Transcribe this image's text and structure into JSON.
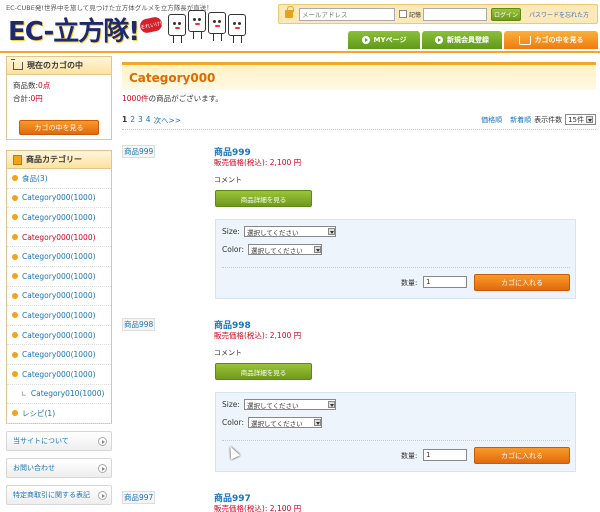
{
  "header": {
    "tagline": "EC-CUBE発!世界中を旅して見つけた立方体グルメを立方隊長が直送！",
    "logo_text": "EC-立方隊!",
    "logo_badge": "それいけ!",
    "login": {
      "email_placeholder": "メールアドレス",
      "remember_label": "記憶",
      "login_button": "ログイン",
      "forgot_link": "パスワードを忘れた方"
    },
    "nav": {
      "mypage": "MYページ",
      "register": "新規会員登録",
      "cart": "カゴの中を見る"
    },
    "colors": {
      "accent": "#f5a623",
      "green": "#6e9a1a",
      "orange": "#e3690c",
      "link": "#1a74b8",
      "price_red": "#d0021b"
    }
  },
  "sidebar": {
    "cart": {
      "title": "現在のカゴの中",
      "count_label": "商品数:",
      "count_value": "0点",
      "total_label": "合計:",
      "total_value": "0円",
      "view_button": "カゴの中を見る"
    },
    "categories": {
      "title": "商品カテゴリー",
      "items": [
        {
          "label": "食品(3)"
        },
        {
          "label": "Category000(1000)"
        },
        {
          "label": "Category000(1000)"
        },
        {
          "label": "Category000(1000)"
        },
        {
          "label": "Category000(1000)"
        },
        {
          "label": "Category000(1000)"
        },
        {
          "label": "Category000(1000)"
        },
        {
          "label": "Category000(1000)"
        },
        {
          "label": "Category000(1000)"
        },
        {
          "label": "Category000(1000)"
        },
        {
          "label": "Category000(1000)"
        },
        {
          "label": "Category010(1000)"
        },
        {
          "label": "レシピ(1)"
        }
      ]
    },
    "links": {
      "about": "当サイトについて",
      "contact": "お問い合わせ",
      "law": "特定商取引に関する表記"
    }
  },
  "main": {
    "heading": "Category000",
    "count_number": "1000件",
    "count_suffix": "の商品がございます。",
    "pager": {
      "current": "1",
      "pages": [
        "2",
        "3",
        "4"
      ],
      "next": "次へ>>"
    },
    "sort": {
      "by_price": "価格順",
      "by_new": "新着順",
      "per_page_label": "表示件数",
      "per_page_value": "15件"
    },
    "products": [
      {
        "thumb": "商品999",
        "name": "商品999",
        "price_label": "販売価格(税込):",
        "price": "2,100 円",
        "comment": "コメント",
        "detail_button": "商品詳細を見る",
        "size_label": "Size:",
        "size_value": "選択してください",
        "color_label": "Color:",
        "color_value": "選択してください",
        "qty_label": "数量:",
        "qty_value": "1",
        "cart_button": "カゴに入れる"
      },
      {
        "thumb": "商品998",
        "name": "商品998",
        "price_label": "販売価格(税込):",
        "price": "2,100 円",
        "comment": "コメント",
        "detail_button": "商品詳細を見る",
        "size_label": "Size:",
        "size_value": "選択してください",
        "color_label": "Color:",
        "color_value": "選択してください",
        "qty_label": "数量:",
        "qty_value": "1",
        "cart_button": "カゴに入れる"
      },
      {
        "thumb": "商品997",
        "name": "商品997",
        "price_label": "販売価格(税込):",
        "price": "2,100 円"
      }
    ]
  }
}
